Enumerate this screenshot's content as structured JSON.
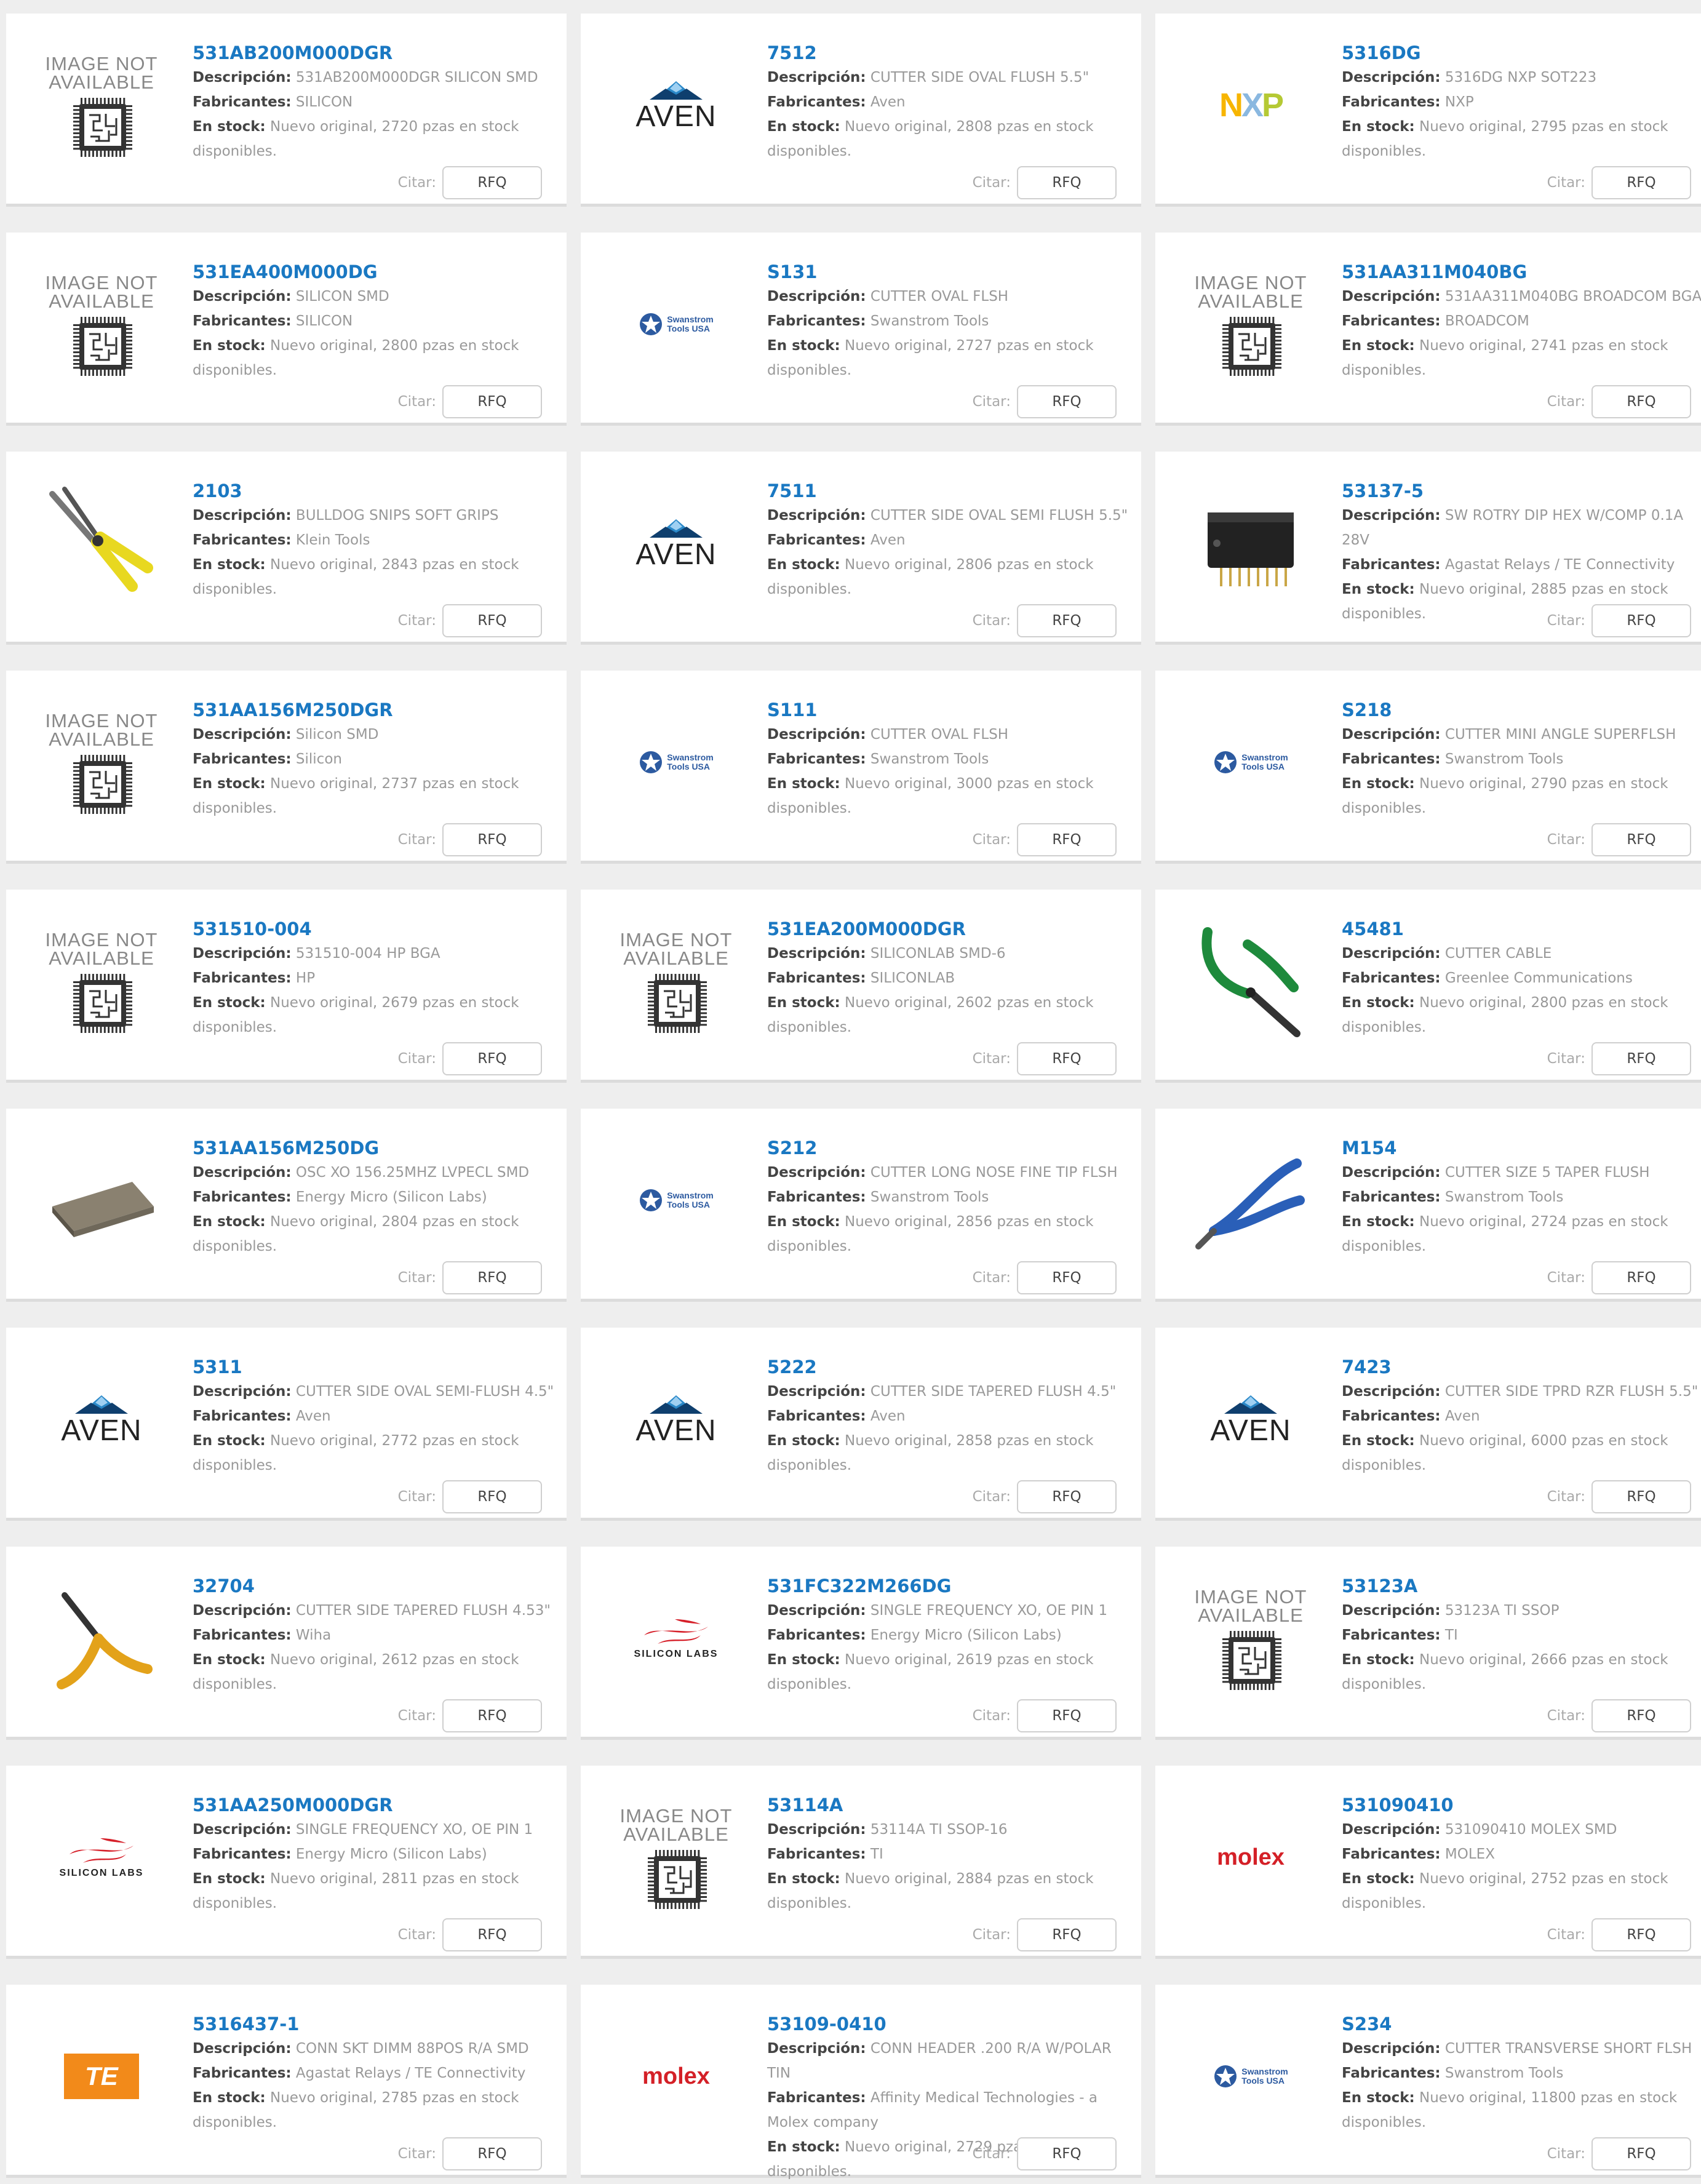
{
  "labels": {
    "description": "Descripción:",
    "manufacturer": "Fabricantes:",
    "stock": "En stock:",
    "quote": "Citar:",
    "rfq": "RFQ"
  },
  "image_not_available": [
    "IMAGE NOT",
    "AVAILABLE"
  ],
  "logo_text": {
    "aven": "AVEN",
    "nxp": "NXP",
    "swanstrom": [
      "Swanstrom",
      "Tools USA"
    ],
    "molex": "molex",
    "silicon_labs": "SILICON LABS",
    "te": "TE"
  },
  "colors": {
    "part_link": "#1a78c2",
    "muted_text": "#999999",
    "label_text": "#444444",
    "background": "#eeeeee",
    "aven_blue": "#2a88c8",
    "silabs_red": "#d6202a",
    "molex_red": "#d42027",
    "te_orange": "#f28a1a"
  },
  "products": [
    {
      "part": "531AB200M000DGR",
      "desc": "531AB200M000DGR SILICON SMD",
      "mfr": "SILICON",
      "stock": "Nuevo original, 2720 pzas en stock disponibles.",
      "image": "image-not-available"
    },
    {
      "part": "7512",
      "desc": "CUTTER SIDE OVAL FLUSH 5.5\"",
      "mfr": "Aven",
      "stock": "Nuevo original, 2808 pzas en stock disponibles.",
      "image": "aven-logo"
    },
    {
      "part": "5316DG",
      "desc": "5316DG NXP SOT223",
      "mfr": "NXP",
      "stock": "Nuevo original, 2795 pzas en stock disponibles.",
      "image": "nxp-logo"
    },
    {
      "part": "531EA400M000DG",
      "desc": "SILICON SMD",
      "mfr": "SILICON",
      "stock": "Nuevo original, 2800 pzas en stock disponibles.",
      "image": "image-not-available"
    },
    {
      "part": "S131",
      "desc": "CUTTER OVAL FLSH",
      "mfr": "Swanstrom Tools",
      "stock": "Nuevo original, 2727 pzas en stock disponibles.",
      "image": "swanstrom-logo"
    },
    {
      "part": "531AA311M040BG",
      "desc": "531AA311M040BG BROADCOM BGA",
      "mfr": "BROADCOM",
      "stock": "Nuevo original, 2741 pzas en stock disponibles.",
      "image": "image-not-available"
    },
    {
      "part": "2103",
      "desc": "BULLDOG SNIPS SOFT GRIPS",
      "mfr": "Klein Tools",
      "stock": "Nuevo original, 2843 pzas en stock disponibles.",
      "image": "snips-photo"
    },
    {
      "part": "7511",
      "desc": "CUTTER SIDE OVAL SEMI FLUSH 5.5\"",
      "mfr": "Aven",
      "stock": "Nuevo original, 2806 pzas en stock disponibles.",
      "image": "aven-logo"
    },
    {
      "part": "53137-5",
      "desc": "SW ROTRY DIP HEX W/COMP 0.1A 28V",
      "mfr": "Agastat Relays / TE Connectivity",
      "stock": "Nuevo original, 2885 pzas en stock disponibles.",
      "image": "dip-switch-photo"
    },
    {
      "part": "531AA156M250DGR",
      "desc": "Silicon SMD",
      "mfr": "Silicon",
      "stock": "Nuevo original, 2737 pzas en stock disponibles.",
      "image": "image-not-available"
    },
    {
      "part": "S111",
      "desc": "CUTTER OVAL FLSH",
      "mfr": "Swanstrom Tools",
      "stock": "Nuevo original, 3000 pzas en stock disponibles.",
      "image": "swanstrom-logo"
    },
    {
      "part": "S218",
      "desc": "CUTTER MINI ANGLE SUPERFLSH",
      "mfr": "Swanstrom Tools",
      "stock": "Nuevo original, 2790 pzas en stock disponibles.",
      "image": "swanstrom-logo"
    },
    {
      "part": "531510-004",
      "desc": "531510-004 HP BGA",
      "mfr": "HP",
      "stock": "Nuevo original, 2679 pzas en stock disponibles.",
      "image": "image-not-available"
    },
    {
      "part": "531EA200M000DGR",
      "desc": "SILICONLAB SMD-6",
      "mfr": "SILICONLAB",
      "stock": "Nuevo original, 2602 pzas en stock disponibles.",
      "image": "image-not-available"
    },
    {
      "part": "45481",
      "desc": "CUTTER CABLE",
      "mfr": "Greenlee Communications",
      "stock": "Nuevo original, 2800 pzas en stock disponibles.",
      "image": "green-cutter-photo"
    },
    {
      "part": "531AA156M250DG",
      "desc": "OSC XO 156.25MHZ LVPECL SMD",
      "mfr": "Energy Micro (Silicon Labs)",
      "stock": "Nuevo original, 2804 pzas en stock disponibles.",
      "image": "oscillator-photo"
    },
    {
      "part": "S212",
      "desc": "CUTTER LONG NOSE FINE TIP FLSH",
      "mfr": "Swanstrom Tools",
      "stock": "Nuevo original, 2856 pzas en stock disponibles.",
      "image": "swanstrom-logo"
    },
    {
      "part": "M154",
      "desc": "CUTTER SIZE 5 TAPER FLUSH",
      "mfr": "Swanstrom Tools",
      "stock": "Nuevo original, 2724 pzas en stock disponibles.",
      "image": "blue-cutter-photo"
    },
    {
      "part": "5311",
      "desc": "CUTTER SIDE OVAL SEMI-FLUSH 4.5\"",
      "mfr": "Aven",
      "stock": "Nuevo original, 2772 pzas en stock disponibles.",
      "image": "aven-logo"
    },
    {
      "part": "5222",
      "desc": "CUTTER SIDE TAPERED FLUSH 4.5\"",
      "mfr": "Aven",
      "stock": "Nuevo original, 2858 pzas en stock disponibles.",
      "image": "aven-logo"
    },
    {
      "part": "7423",
      "desc": "CUTTER SIDE TPRD RZR FLUSH 5.5\"",
      "mfr": "Aven",
      "stock": "Nuevo original, 6000 pzas en stock disponibles.",
      "image": "aven-logo"
    },
    {
      "part": "32704",
      "desc": "CUTTER SIDE TAPERED FLUSH 4.53\"",
      "mfr": "Wiha",
      "stock": "Nuevo original, 2612 pzas en stock disponibles.",
      "image": "yellow-cutter-photo"
    },
    {
      "part": "531FC322M266DG",
      "desc": "SINGLE FREQUENCY XO, OE PIN 1",
      "mfr": "Energy Micro (Silicon Labs)",
      "stock": "Nuevo original, 2619 pzas en stock disponibles.",
      "image": "silicon-labs-logo"
    },
    {
      "part": "53123A",
      "desc": "53123A TI SSOP",
      "mfr": "TI",
      "stock": "Nuevo original, 2666 pzas en stock disponibles.",
      "image": "image-not-available"
    },
    {
      "part": "531AA250M000DGR",
      "desc": "SINGLE FREQUENCY XO, OE PIN 1",
      "mfr": "Energy Micro (Silicon Labs)",
      "stock": "Nuevo original, 2811 pzas en stock disponibles.",
      "image": "silicon-labs-logo"
    },
    {
      "part": "53114A",
      "desc": "53114A TI SSOP-16",
      "mfr": "TI",
      "stock": "Nuevo original, 2884 pzas en stock disponibles.",
      "image": "image-not-available"
    },
    {
      "part": "531090410",
      "desc": "531090410 MOLEX SMD",
      "mfr": "MOLEX",
      "stock": "Nuevo original, 2752 pzas en stock disponibles.",
      "image": "molex-logo"
    },
    {
      "part": "5316437-1",
      "desc": "CONN SKT DIMM 88POS R/A SMD",
      "mfr": "Agastat Relays / TE Connectivity",
      "stock": "Nuevo original, 2785 pzas en stock disponibles.",
      "image": "te-logo"
    },
    {
      "part": "53109-0410",
      "desc": "CONN HEADER .200 R/A W/POLAR TIN",
      "mfr": "Affinity Medical Technologies - a Molex company",
      "stock": "Nuevo original, 2729 pzas en stock disponibles.",
      "image": "molex-logo"
    },
    {
      "part": "S234",
      "desc": "CUTTER TRANSVERSE SHORT FLSH",
      "mfr": "Swanstrom Tools",
      "stock": "Nuevo original, 11800 pzas en stock disponibles.",
      "image": "swanstrom-logo"
    }
  ]
}
